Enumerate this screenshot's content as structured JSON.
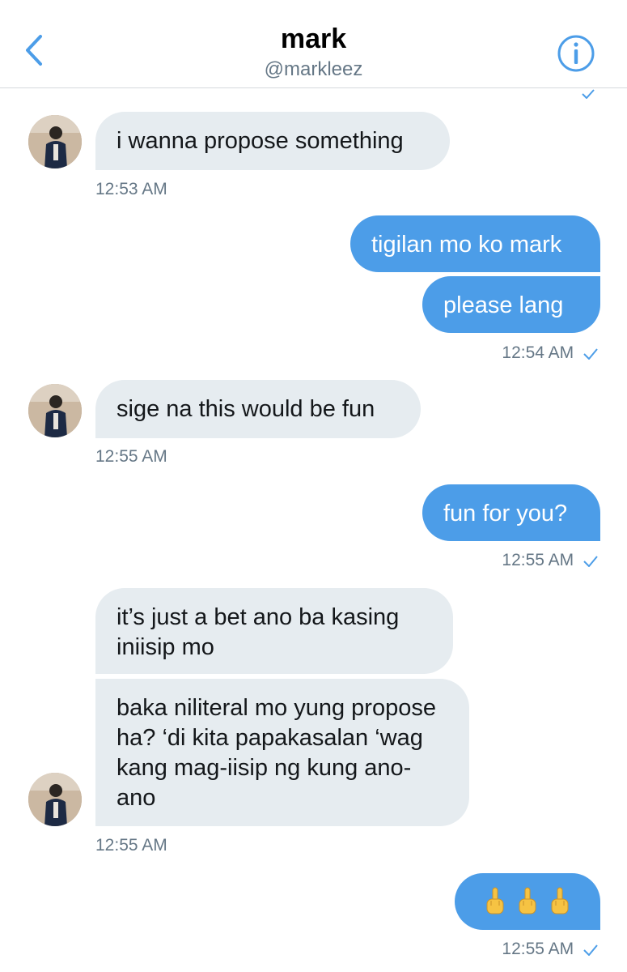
{
  "header": {
    "title": "mark",
    "handle": "@markleez",
    "back_icon": "chevron-left-icon",
    "info_icon": "info-icon"
  },
  "colors": {
    "accent": "#4c9de8",
    "incoming_bubble": "#e6ecf0",
    "timestamp": "#657786"
  },
  "messages": [
    {
      "from": "mark",
      "text": "i wanna propose something",
      "time": "12:53 AM"
    },
    {
      "from": "me",
      "text": "tigilan mo ko mark"
    },
    {
      "from": "me",
      "text": "please lang",
      "time": "12:54 AM"
    },
    {
      "from": "mark",
      "text": "sige na this would be fun",
      "time": "12:55 AM"
    },
    {
      "from": "me",
      "text": "fun for you?",
      "time": "12:55 AM"
    },
    {
      "from": "mark",
      "text": "it’s just a bet ano ba kasing iniisip mo"
    },
    {
      "from": "mark",
      "text": "baka niliteral mo yung propose ha? ‘di kita papakasalan ‘wag kang mag-iisip ng kung ano-ano",
      "time": "12:55 AM"
    },
    {
      "from": "me",
      "text": "🖕🖕🖕",
      "time": "12:55 AM"
    }
  ]
}
